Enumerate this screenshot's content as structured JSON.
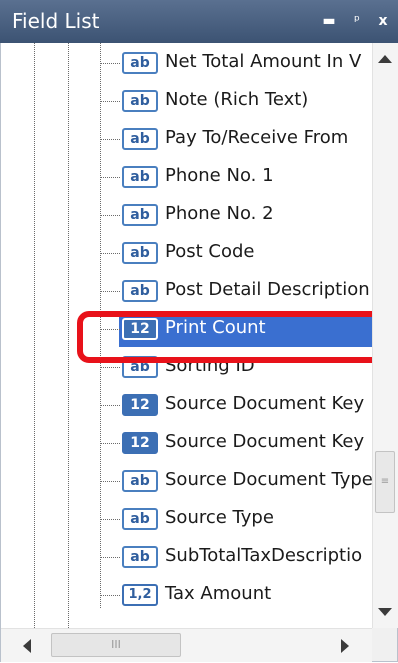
{
  "panel": {
    "title": "Field List",
    "buttons": {
      "maximize": "▬",
      "pin": "ᵖ",
      "close": "x"
    }
  },
  "fields": [
    {
      "label": "Net Total Amount In V",
      "icon_text": "ab",
      "icon": "text-field-icon"
    },
    {
      "label": "Note (Rich Text)",
      "icon_text": "ab",
      "icon": "text-field-icon"
    },
    {
      "label": "Pay To/Receive From",
      "icon_text": "ab",
      "icon": "text-field-icon"
    },
    {
      "label": "Phone No. 1",
      "icon_text": "ab",
      "icon": "text-field-icon"
    },
    {
      "label": "Phone No. 2",
      "icon_text": "ab",
      "icon": "text-field-icon"
    },
    {
      "label": "Post Code",
      "icon_text": "ab",
      "icon": "text-field-icon"
    },
    {
      "label": "Post Detail Description",
      "icon_text": "ab",
      "icon": "text-field-icon"
    },
    {
      "label": "Print Count",
      "icon_text": "12",
      "icon": "integer-field-icon",
      "selected": true
    },
    {
      "label": "Sorting ID",
      "icon_text": "ab",
      "icon": "text-field-icon"
    },
    {
      "label": "Source Document Key",
      "icon_text": "12",
      "icon": "integer-field-icon"
    },
    {
      "label": "Source Document Key",
      "icon_text": "12",
      "icon": "integer-field-icon"
    },
    {
      "label": "Source Document Type",
      "icon_text": "ab",
      "icon": "text-field-icon"
    },
    {
      "label": "Source Type",
      "icon_text": "ab",
      "icon": "text-field-icon"
    },
    {
      "label": "SubTotalTaxDescriptio",
      "icon_text": "ab",
      "icon": "text-field-icon"
    },
    {
      "label": "Tax Amount",
      "icon_text": "1,2",
      "icon": "decimal-field-icon"
    }
  ],
  "scrollbars": {
    "vertical_grip": "≡",
    "horizontal_grip": "III"
  },
  "colors": {
    "title_bar": "#4a6385",
    "selection": "#3a6fd0",
    "highlight_border": "#e8121a",
    "icon_border": "#4a7fbf"
  }
}
